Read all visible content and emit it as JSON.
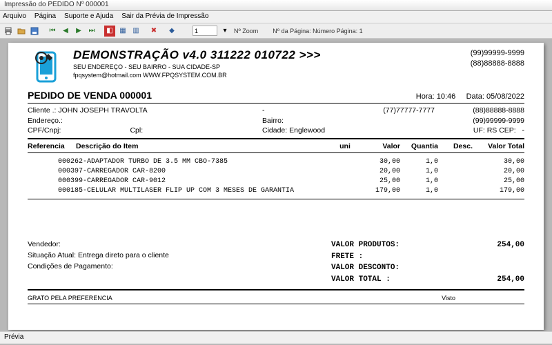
{
  "window": {
    "title": "Impressão do PEDIDO Nº 000001"
  },
  "menu": {
    "arquivo": "Arquivo",
    "pagina": "Página",
    "suporte": "Suporte e Ajuda",
    "sair": "Sair da Prévia de Impressão"
  },
  "toolbar": {
    "zoom": "1",
    "zoom_lbl": "Nº Zoom",
    "page_lbl": "Nº da Página: Número Página: 1"
  },
  "company": {
    "name": "DEMONSTRAÇÃO v4.0 311222 010722 >>>",
    "addr": "SEU ENDEREÇO - SEU BAIRRO - SUA CIDADE-SP",
    "contact": "fpqsystem@hotmail.com   WWW.FPQSYSTEM.COM.BR",
    "phone1": "(99)99999-9999",
    "phone2": "(88)88888-8888"
  },
  "order": {
    "title": "PEDIDO DE VENDA 000001",
    "hora_lbl": "Hora:",
    "hora": "10:46",
    "data_lbl": "Data:",
    "data": "05/08/2022"
  },
  "client": {
    "l1_lbl": "Cliente   .:",
    "name": "JOHN JOSEPH TRAVOLTA",
    "dash": "-",
    "phone1": "(77)77777-7777",
    "phone2": "(88)88888-8888",
    "l2_lbl": "Endereço.:",
    "bairro_lbl": "Bairro:",
    "phone3": "(99)99999-9999",
    "l3_lbl": "CPF/Cnpj:",
    "cpl_lbl": "Cpl:",
    "cidade_lbl": "Cidade:",
    "cidade": "Englewood",
    "uf_lbl": "UF:",
    "uf": "RS",
    "cep_lbl": "CEP:",
    "cep": "-"
  },
  "headers": {
    "ref": "Referencia",
    "desc": "Descrição do Item",
    "uni": "uni",
    "valor": "Valor",
    "quantia": "Quantia",
    "desconto": "Desc.",
    "total": "Valor Total"
  },
  "items": [
    {
      "desc": "000262-ADAPTADOR TURBO DE 3.5 MM CBO-7385",
      "valor": "30,00",
      "qty": "1,0",
      "total": "30,00"
    },
    {
      "desc": "000397-CARREGADOR CAR-8200",
      "valor": "20,00",
      "qty": "1,0",
      "total": "20,00"
    },
    {
      "desc": "000399-CARREGADOR CAR-9012",
      "valor": "25,00",
      "qty": "1,0",
      "total": "25,00"
    },
    {
      "desc": "000185-CELULAR MULTILASER FLIP UP COM 3 MESES DE GARANTIA",
      "valor": "179,00",
      "qty": "1,0",
      "total": "179,00"
    }
  ],
  "summary": {
    "vendedor_lbl": "Vendedor:",
    "situacao_lbl": "Situação Atual:",
    "situacao": "Entrega direto para o cliente",
    "condicoes_lbl": "Condições de Pagamento:",
    "produtos_lbl": "VALOR PRODUTOS:",
    "produtos": "254,00",
    "frete_lbl": "FRETE         :",
    "desconto_lbl": "VALOR DESCONTO:",
    "total_lbl": "VALOR TOTAL   :",
    "total": "254,00"
  },
  "footer": {
    "thanks": "GRATO PELA PREFERENCIA",
    "visto": "Visto"
  },
  "status": {
    "text": "Prévia"
  }
}
